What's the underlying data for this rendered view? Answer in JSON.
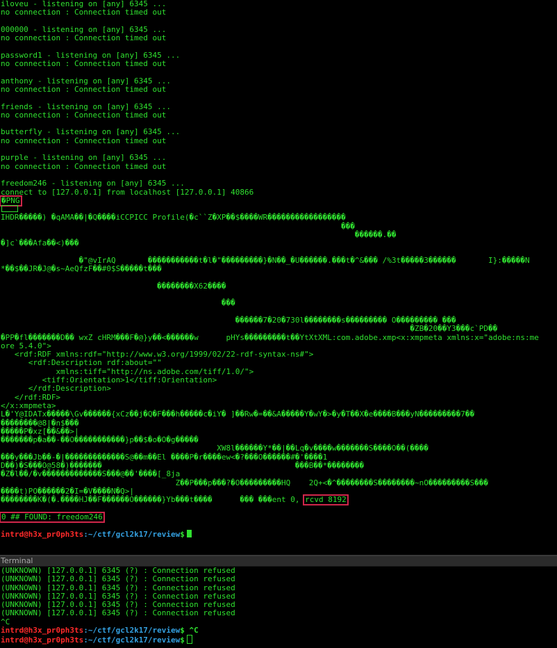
{
  "top_terminal": {
    "blocks": [
      {
        "listen": "iloveu - listening on [any] 6345 ...",
        "status": "no connection : Connection timed out"
      },
      {
        "listen": "000000 - listening on [any] 6345 ...",
        "status": "no connection : Connection timed out"
      },
      {
        "listen": "password1 - listening on [any] 6345 ...",
        "status": "no connection : Connection timed out"
      },
      {
        "listen": "anthony - listening on [any] 6345 ...",
        "status": "no connection : Connection timed out"
      },
      {
        "listen": "friends - listening on [any] 6345 ...",
        "status": "no connection : Connection timed out"
      },
      {
        "listen": "butterfly - listening on [any] 6345 ...",
        "status": "no connection : Connection timed out"
      },
      {
        "listen": "purple - listening on [any] 6345 ...",
        "status": "no connection : Connection timed out"
      }
    ],
    "found_listen": "freedom246 - listening on [any] 6345 ...",
    "connect": "connect to [127.0.0.1] from localhost [127.0.0.1] 40866",
    "png_marker": "�PNG",
    "binary_lines": [
      "IHDR�����) �qAMA��|�Q����iCCPICC Profile(�c``Z�XP��$����WR�����������������",
      "                                                                          ���",
      "                                                                             ������.��",
      "�]c`���Afa��<)���",
      "",
      "                 �\"@vIrAQ       �����������t�l�\"���������}�N��_�U������.���t�^&��� /%3t�����3������       I}:�����N",
      "*��$��JR�J@�s~AeQfzF��#0$S�����t���",
      "",
      "                                  ��������X62����",
      "",
      "                                                ���",
      "",
      "                                                   ������7�20�730l��������s��������� O��������� ���",
      "                                                                                         �ZB�20��Y3���c`PD��",
      "�PP�fl�������D�� wxZ cHRM���F�@}y��<������w      pHYs���������t��YtXtXML:com.adobe.xmp<x:xmpmeta xmlns:x=\"adobe:ns:me",
      "ore 5.4.0\">",
      "   <rdf:RDF xmlns:rdf=\"http://www.w3.org/1999/02/22-rdf-syntax-ns#\">",
      "      <rdf:Description rdf:about=\"\"",
      "            xmlns:tiff=\"http://ns.adobe.com/tiff/1.0/\">",
      "         <tiff:Orientation>1</tiff:Orientation>",
      "      </rdf:Description>",
      "   </rdf:RDF>",
      "</x:xmpmeta>",
      "L�'Y@IDATx�����\\Gv������{xCz��j�Q�F���h�����c�iY� ]��Rw�=��&A�����Y�wY�>�y�T��X�e����B���yN���������7��",
      "��������@8|�n$���",
      "�����P�xz[��&��>|",
      "�������p�a��-��O�����������}p��$�o�O�g�����",
      "                                               XW8l������Y*��|��Lq�v����w�������S����O��(����",
      "���y���Jb��-�|�������������S@��m��El ����P�r����ew<�?���O������#�'����1",
      "D��)�S���O@58�)�������                                          ���B��*��������",
      "�Z�l��/�v�������������S���@��'����[_8ja",
      "                                      Z��P���p���?�O���������HQ    2Q+<�^��������S��������~nO���������S���",
      "����t)PO������2�I=�V����N�Q>|"
    ],
    "last_binary_prefix": "��������K�(�.����HJ��F������O������}Yb���t����      ��� ���ent 0, ",
    "rcvd": "rcvd 8192",
    "found": "0 ## FOUND: freedom246",
    "prompt_user": "intrd@h3x_pr0ph3ts",
    "prompt_path": ":~/ctf/gcl2k17/review",
    "prompt_symbol": "$"
  },
  "bottom_terminal": {
    "title": "Terminal",
    "lines": [
      "(UNKNOWN) [127.0.0.1] 6345 (?) : Connection refused",
      "(UNKNOWN) [127.0.0.1] 6345 (?) : Connection refused",
      "(UNKNOWN) [127.0.0.1] 6345 (?) : Connection refused",
      "(UNKNOWN) [127.0.0.1] 6345 (?) : Connection refused",
      "(UNKNOWN) [127.0.0.1] 6345 (?) : Connection refused",
      "(UNKNOWN) [127.0.0.1] 6345 (?) : Connection refused"
    ],
    "ctrl_c": "^C",
    "prompt1_user": "intrd@h3x_pr0ph3ts",
    "prompt1_path": ":~/ctf/gcl2k17/review",
    "prompt1_cmd": "$ ^C",
    "prompt2_user": "intrd@h3x_pr0ph3ts",
    "prompt2_path": ":~/ctf/gcl2k17/review",
    "prompt2_cmd": "$"
  },
  "colors": {
    "text": "#2fe02f",
    "highlight_box": "#d0264a",
    "prompt_user": "#ff2a2a",
    "prompt_path": "#34a0e0"
  }
}
